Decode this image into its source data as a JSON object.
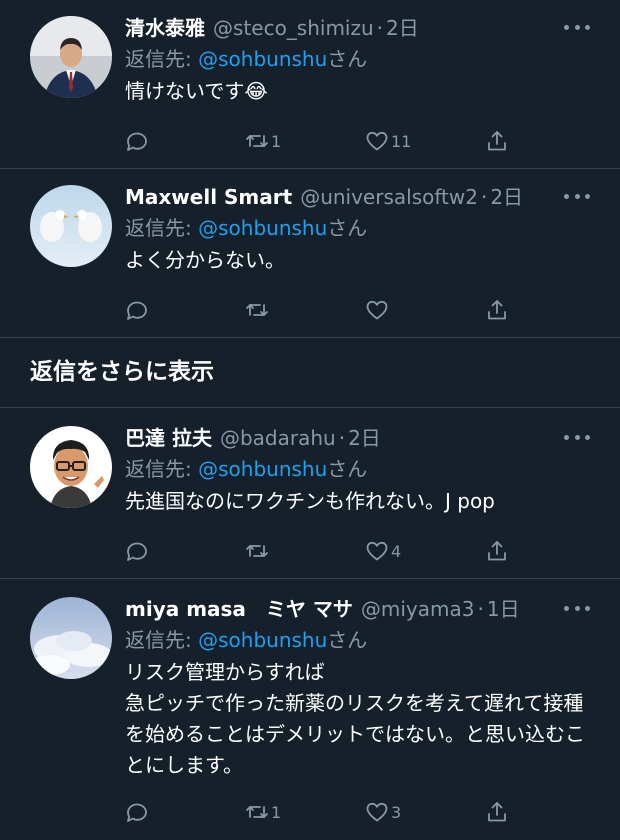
{
  "colors": {
    "background": "#15202b",
    "text": "#ffffff",
    "muted": "#8899a6",
    "link": "#1da1f2",
    "divider": "#38444d"
  },
  "icons": {
    "reply": "reply-icon",
    "retweet": "retweet-icon",
    "like": "heart-icon",
    "share": "share-icon",
    "more": "more-icon"
  },
  "show_more_label": "返信をさらに表示",
  "tweets": [
    {
      "name": "清水泰雅",
      "handle": "@steco_shimizu",
      "time": "2日",
      "reply_prefix": "返信先: ",
      "reply_to": "@sohbunshu",
      "reply_suffix": "さん",
      "text": "情けないです😂",
      "counts": {
        "reply": "",
        "retweet": "1",
        "like": "11"
      }
    },
    {
      "name": "Maxwell Smart",
      "handle": "@universalsoftw2",
      "time": "2日",
      "reply_prefix": "返信先: ",
      "reply_to": "@sohbunshu",
      "reply_suffix": "さん",
      "text": "よく分からない。",
      "counts": {
        "reply": "",
        "retweet": "",
        "like": ""
      }
    },
    {
      "name": "巴達 拉夫",
      "handle": "@badarahu",
      "time": "2日",
      "reply_prefix": "返信先: ",
      "reply_to": "@sohbunshu",
      "reply_suffix": "さん",
      "text": "先進国なのにワクチンも作れない。J pop",
      "counts": {
        "reply": "",
        "retweet": "",
        "like": "4"
      }
    },
    {
      "name": "miya masa　ミヤ マサ",
      "handle": "@miyama3",
      "time": "1日",
      "reply_prefix": "返信先: ",
      "reply_to": "@sohbunshu",
      "reply_suffix": "さん",
      "text": "リスク管理からすれば\n急ピッチで作った新薬のリスクを考えて遅れて接種を始めることはデメリットではない。と思い込むことにします。",
      "counts": {
        "reply": "",
        "retweet": "1",
        "like": "3"
      }
    }
  ]
}
